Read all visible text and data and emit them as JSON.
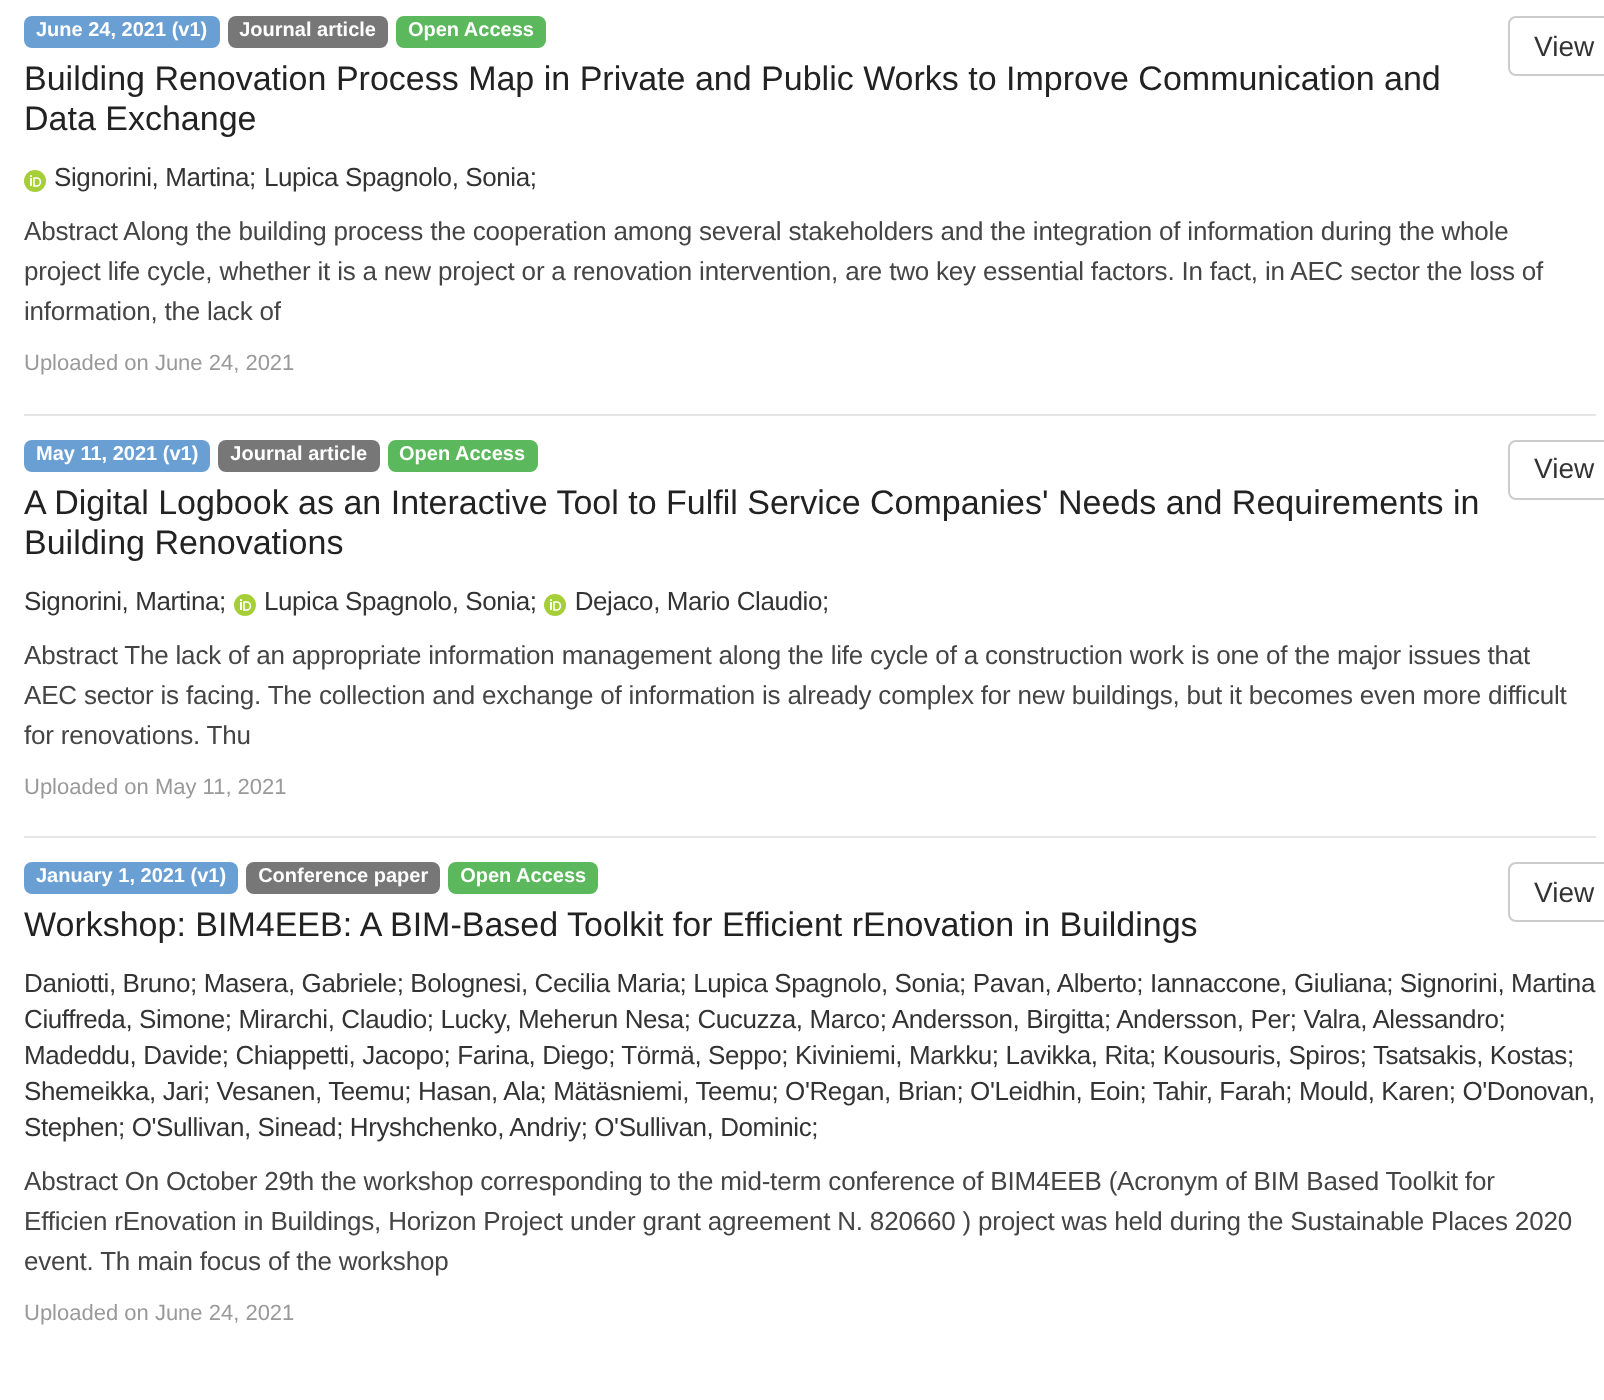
{
  "records": [
    {
      "badges": [
        {
          "kind": "date",
          "text": "June 24, 2021 (v1)"
        },
        {
          "kind": "type",
          "text": "Journal article"
        },
        {
          "kind": "access",
          "text": "Open Access"
        }
      ],
      "view_button": "View",
      "title": "Building Renovation Process Map in Private and Public Works to Improve Communication and Data Exchange",
      "authors": [
        {
          "name": "Signorini, Martina;",
          "orcid": true
        },
        {
          "name": "Lupica Spagnolo, Sonia;",
          "orcid": false
        }
      ],
      "abstract": "Abstract Along the building process the cooperation among several stakeholders and the integration of information during the whole project life cycle, whether it is a new project or a renovation intervention, are two key essential factors. In fact, in AEC sector the loss of information, the lack of",
      "uploaded": "Uploaded on June 24, 2021"
    },
    {
      "badges": [
        {
          "kind": "date",
          "text": "May 11, 2021 (v1)"
        },
        {
          "kind": "type",
          "text": "Journal article"
        },
        {
          "kind": "access",
          "text": "Open Access"
        }
      ],
      "view_button": "View",
      "title": "A Digital Logbook as an Interactive Tool to Fulfil Service Companies' Needs and Requirements in Building Renovations",
      "authors": [
        {
          "name": "Signorini, Martina;",
          "orcid": false
        },
        {
          "name": "Lupica Spagnolo, Sonia;",
          "orcid": true
        },
        {
          "name": "Dejaco, Mario Claudio;",
          "orcid": true
        }
      ],
      "abstract": "Abstract The lack of an appropriate information management along the life cycle of a construction work is one of the major issues that AEC sector is facing. The collection and exchange of information is already complex for new buildings, but it becomes even more difficult for renovations. Thu",
      "uploaded": "Uploaded on May 11, 2021"
    },
    {
      "badges": [
        {
          "kind": "date",
          "text": "January 1, 2021 (v1)"
        },
        {
          "kind": "type",
          "text": "Conference paper"
        },
        {
          "kind": "access",
          "text": "Open Access"
        }
      ],
      "view_button": "View",
      "title": "Workshop: BIM4EEB: A BIM-Based Toolkit for Efficient rEnovation in Buildings",
      "authors": [
        {
          "name": "Daniotti, Bruno; Masera, Gabriele; Bolognesi, Cecilia Maria; Lupica Spagnolo, Sonia; Pavan, Alberto; Iannaccone, Giuliana; Signorini, Martina Ciuffreda, Simone; Mirarchi, Claudio; Lucky, Meherun Nesa; Cucuzza, Marco; Andersson, Birgitta; Andersson, Per; Valra, Alessandro; Madeddu, Davide; Chiappetti, Jacopo; Farina, Diego; Törmä, Seppo; Kiviniemi, Markku; Lavikka, Rita; Kousouris, Spiros; Tsatsakis, Kostas; Shemeikka, Jari; Vesanen, Teemu; Hasan, Ala; Mätäsniemi, Teemu; O'Regan, Brian; O'Leidhin, Eoin; Tahir, Farah; Mould, Karen; O'Donovan, Stephen; O'Sullivan, Sinead; Hryshchenko, Andriy; O'Sullivan, Dominic;",
          "orcid": false
        }
      ],
      "abstract": "Abstract On October 29th the workshop corresponding to the mid-term conference of BIM4EEB (Acronym of BIM Based Toolkit for Efficien rEnovation in Buildings, Horizon Project under grant agreement N. 820660 ) project was held during the Sustainable Places 2020 event. Th main focus of the workshop",
      "uploaded": "Uploaded on June 24, 2021"
    }
  ]
}
